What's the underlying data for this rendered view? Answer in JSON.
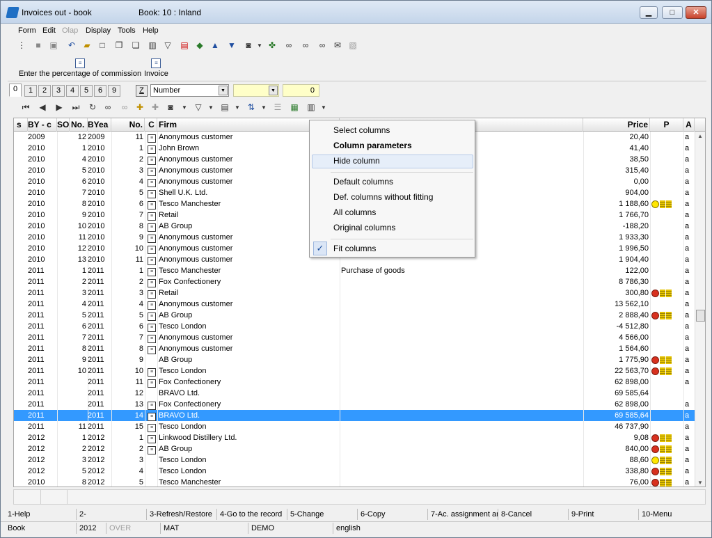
{
  "window": {
    "title": "Invoices out - book",
    "book": "Book: 10 : Inland",
    "min": "▁",
    "max": "□",
    "close": "✕"
  },
  "menu": [
    "Form",
    "Edit",
    "Olap",
    "Display",
    "Tools",
    "Help"
  ],
  "panel": {
    "commission": "Enter the percentage of commission",
    "invoice": "Invoice"
  },
  "tabs": [
    "0",
    "1",
    "2",
    "3",
    "4",
    "5",
    "6",
    "9"
  ],
  "filter": {
    "z": "Z",
    "field": "Number",
    "num": "0"
  },
  "columns": [
    "s",
    "BY - c",
    "SO",
    "No.",
    "BYea",
    "No.",
    "C",
    "Firm",
    "Price",
    "P",
    "A"
  ],
  "rows": [
    {
      "by": "2009",
      "so": "",
      "no": "12",
      "byear": "2009",
      "no2": "11",
      "doc": true,
      "firm": "Anonymous customer",
      "note": "",
      "price": "20,40",
      "icons": "",
      "a": "a"
    },
    {
      "by": "2010",
      "so": "",
      "no": "1",
      "byear": "2010",
      "no2": "1",
      "doc": true,
      "firm": "John Brown",
      "note": "",
      "price": "41,40",
      "icons": "",
      "a": "a"
    },
    {
      "by": "2010",
      "so": "",
      "no": "4",
      "byear": "2010",
      "no2": "2",
      "doc": true,
      "firm": "Anonymous customer",
      "note": "",
      "price": "38,50",
      "icons": "",
      "a": "a"
    },
    {
      "by": "2010",
      "so": "",
      "no": "5",
      "byear": "2010",
      "no2": "3",
      "doc": true,
      "firm": "Anonymous customer",
      "note": "",
      "price": "315,40",
      "icons": "",
      "a": "a"
    },
    {
      "by": "2010",
      "so": "",
      "no": "6",
      "byear": "2010",
      "no2": "4",
      "doc": true,
      "firm": "Anonymous customer",
      "note": "",
      "price": "0,00",
      "icons": "",
      "a": "a"
    },
    {
      "by": "2010",
      "so": "",
      "no": "7",
      "byear": "2010",
      "no2": "5",
      "doc": true,
      "firm": "Shell U.K. Ltd.",
      "note": "",
      "price": "904,00",
      "icons": "",
      "a": "a"
    },
    {
      "by": "2010",
      "so": "",
      "no": "8",
      "byear": "2010",
      "no2": "6",
      "doc": true,
      "firm": "Tesco Manchester",
      "note": "",
      "price": "1 188,60",
      "icons": "smile",
      "a": "a"
    },
    {
      "by": "2010",
      "so": "",
      "no": "9",
      "byear": "2010",
      "no2": "7",
      "doc": true,
      "firm": "Retail",
      "note": "",
      "price": "1 766,70",
      "icons": "",
      "a": "a"
    },
    {
      "by": "2010",
      "so": "",
      "no": "10",
      "byear": "2010",
      "no2": "8",
      "doc": true,
      "firm": "AB Group",
      "note": "",
      "price": "-188,20",
      "icons": "",
      "a": "a"
    },
    {
      "by": "2010",
      "so": "",
      "no": "11",
      "byear": "2010",
      "no2": "9",
      "doc": true,
      "firm": "Anonymous customer",
      "note": "",
      "price": "1 933,30",
      "icons": "",
      "a": "a"
    },
    {
      "by": "2010",
      "so": "",
      "no": "12",
      "byear": "2010",
      "no2": "10",
      "doc": true,
      "firm": "Anonymous customer",
      "note": "",
      "price": "1 996,50",
      "icons": "",
      "a": "a"
    },
    {
      "by": "2010",
      "so": "",
      "no": "13",
      "byear": "2010",
      "no2": "11",
      "doc": true,
      "firm": "Anonymous customer",
      "note": "",
      "price": "1 904,40",
      "icons": "",
      "a": "a"
    },
    {
      "by": "2011",
      "so": "",
      "no": "1",
      "byear": "2011",
      "no2": "1",
      "doc": true,
      "firm": "Tesco Manchester",
      "note": "Purchase of goods",
      "price": "122,00",
      "icons": "",
      "a": "a"
    },
    {
      "by": "2011",
      "so": "",
      "no": "2",
      "byear": "2011",
      "no2": "2",
      "doc": true,
      "firm": "Fox Confectionery",
      "note": "",
      "price": "8 786,30",
      "icons": "",
      "a": "a"
    },
    {
      "by": "2011",
      "so": "",
      "no": "3",
      "byear": "2011",
      "no2": "3",
      "doc": true,
      "firm": "Retail",
      "note": "",
      "price": "300,80",
      "icons": "sad",
      "a": "a"
    },
    {
      "by": "2011",
      "so": "",
      "no": "4",
      "byear": "2011",
      "no2": "4",
      "doc": true,
      "firm": "Anonymous customer",
      "note": "",
      "price": "13 562,10",
      "icons": "",
      "a": "a"
    },
    {
      "by": "2011",
      "so": "",
      "no": "5",
      "byear": "2011",
      "no2": "5",
      "doc": true,
      "firm": "AB Group",
      "note": "",
      "price": "2 888,40",
      "icons": "sad",
      "a": "a"
    },
    {
      "by": "2011",
      "so": "",
      "no": "6",
      "byear": "2011",
      "no2": "6",
      "doc": true,
      "firm": "Tesco London",
      "note": "",
      "price": "-4 512,80",
      "icons": "",
      "a": "a"
    },
    {
      "by": "2011",
      "so": "",
      "no": "7",
      "byear": "2011",
      "no2": "7",
      "doc": true,
      "firm": "Anonymous customer",
      "note": "",
      "price": "4 566,00",
      "icons": "",
      "a": "a"
    },
    {
      "by": "2011",
      "so": "",
      "no": "8",
      "byear": "2011",
      "no2": "8",
      "doc": true,
      "firm": "Anonymous customer",
      "note": "",
      "price": "1 564,60",
      "icons": "",
      "a": "a"
    },
    {
      "by": "2011",
      "so": "",
      "no": "9",
      "byear": "2011",
      "no2": "9",
      "doc": false,
      "firm": "AB Group",
      "note": "",
      "price": "1 775,90",
      "icons": "sad",
      "a": "a"
    },
    {
      "by": "2011",
      "so": "",
      "no": "10",
      "byear": "2011",
      "no2": "10",
      "doc": true,
      "firm": "Tesco London",
      "note": "",
      "price": "22 563,70",
      "icons": "sad",
      "a": "a"
    },
    {
      "by": "2011",
      "so": "",
      "no": "",
      "byear": "2011",
      "no2": "11",
      "doc": true,
      "firm": "Fox Confectionery",
      "note": "",
      "price": "62 898,00",
      "icons": "",
      "a": "a"
    },
    {
      "by": "2011",
      "so": "",
      "no": "",
      "byear": "2011",
      "no2": "12",
      "doc": false,
      "firm": "BRAVO Ltd.",
      "note": "",
      "price": "69 585,64",
      "icons": "",
      "a": ""
    },
    {
      "by": "2011",
      "so": "",
      "no": "",
      "byear": "2011",
      "no2": "13",
      "doc": true,
      "firm": "Fox Confectionery",
      "note": "",
      "price": "62 898,00",
      "icons": "",
      "a": "a"
    },
    {
      "by": "2011",
      "so": "",
      "no": "",
      "byear": "2011",
      "no2": "14",
      "doc": true,
      "firm": "BRAVO Ltd.",
      "note": "",
      "price": "69 585,64",
      "icons": "",
      "a": "a"
    },
    {
      "by": "2011",
      "so": "",
      "no": "11",
      "byear": "2011",
      "no2": "15",
      "doc": true,
      "firm": "Tesco London",
      "note": "",
      "price": "46 737,90",
      "icons": "",
      "a": "a"
    },
    {
      "by": "2012",
      "so": "",
      "no": "1",
      "byear": "2012",
      "no2": "1",
      "doc": true,
      "firm": "Linkwood Distillery Ltd.",
      "note": "",
      "price": "9,08",
      "icons": "sad",
      "a": "a"
    },
    {
      "by": "2012",
      "so": "",
      "no": "2",
      "byear": "2012",
      "no2": "2",
      "doc": true,
      "firm": "AB Group",
      "note": "",
      "price": "840,00",
      "icons": "sad",
      "a": "a"
    },
    {
      "by": "2012",
      "so": "",
      "no": "3",
      "byear": "2012",
      "no2": "3",
      "doc": false,
      "firm": "Tesco London",
      "note": "",
      "price": "88,60",
      "icons": "smile",
      "a": "a"
    },
    {
      "by": "2012",
      "so": "",
      "no": "5",
      "byear": "2012",
      "no2": "4",
      "doc": false,
      "firm": "Tesco London",
      "note": "",
      "price": "338,80",
      "icons": "sad",
      "a": "a"
    },
    {
      "by": "2010",
      "so": "",
      "no": "8",
      "byear": "2012",
      "no2": "5",
      "doc": false,
      "firm": "Tesco Manchester",
      "note": "",
      "price": "76,00",
      "icons": "sad",
      "a": "a"
    }
  ],
  "selected_row": 25,
  "context_menu": {
    "items": [
      "Select columns",
      "Column parameters",
      "Hide column",
      "Default columns",
      "Def. columns without fitting",
      "All columns",
      "Original columns",
      "Fit columns"
    ],
    "check": "✓"
  },
  "fkeys": [
    "1-Help",
    "2-",
    "3-Refresh/Restore",
    "4-Go to the record",
    "5-Change",
    "6-Copy",
    "7-Ac. assignment and",
    "8-Cancel",
    "9-Print",
    "10-Menu"
  ],
  "statusbar": [
    "Book",
    "2012",
    "OVER",
    "MAT",
    "DEMO",
    "english"
  ]
}
